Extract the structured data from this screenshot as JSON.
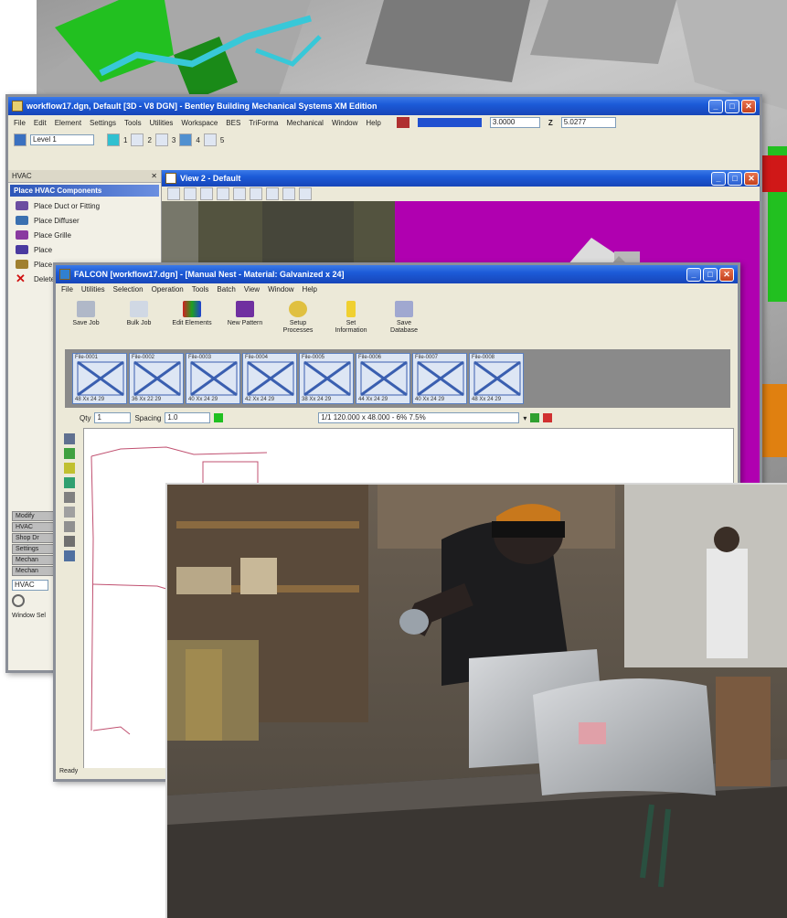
{
  "bentley_window": {
    "title": "workflow17.dgn, Default [3D - V8 DGN] - Bentley Building Mechanical Systems XM Edition",
    "menus": [
      "File",
      "Edit",
      "Element",
      "Settings",
      "Tools",
      "Utilities",
      "Workspace",
      "BES",
      "TriForma",
      "Mechanical",
      "Window",
      "Help"
    ],
    "level_value": "Level 1",
    "z_label": "Z",
    "coord_x": "3.0000",
    "coord_z": "5.0277",
    "toolbar_nums": [
      "1",
      "2",
      "3",
      "4",
      "5"
    ],
    "side_panel": {
      "header": "HVAC",
      "close": "✕",
      "section": "Place HVAC Components",
      "items": [
        "Place Duct or Fitting",
        "Place Diffuser",
        "Place Grille",
        "Place",
        "Place",
        "Delete"
      ],
      "collapsed_tabs": [
        "Modify",
        "HVAC",
        "Shop Dr",
        "Settings",
        "Mechan",
        "Mechan"
      ],
      "bottom_select": "HVAC",
      "status": "Window Sel"
    },
    "view": {
      "title": "View 2 - Default"
    }
  },
  "fab_window": {
    "title": "FALCON [workflow17.dgn] - [Manual Nest - Material: Galvanized x 24]",
    "menus": [
      "File",
      "Utilities",
      "Selection",
      "Operation",
      "Tools",
      "Batch",
      "View",
      "Window",
      "Help"
    ],
    "big_tools": [
      "Save Job",
      "Bulk Job",
      "Edit Elements",
      "New Pattern",
      "Setup Processes",
      "Set Information",
      "Save Database"
    ],
    "thumbnails": [
      {
        "top": "File-0001",
        "bottom": "48 Xx 24 29"
      },
      {
        "top": "File-0002",
        "bottom": "36 Xx 22 29"
      },
      {
        "top": "File-0003",
        "bottom": "40 Xx 24 29"
      },
      {
        "top": "File-0004",
        "bottom": "42 Xx 24 29"
      },
      {
        "top": "File-0005",
        "bottom": "38 Xx 24 29"
      },
      {
        "top": "File-0006",
        "bottom": "44 Xx 24 29"
      },
      {
        "top": "File-0007",
        "bottom": "40 Xx 24 29"
      },
      {
        "top": "File-0008",
        "bottom": "48 Xx 24 29"
      }
    ],
    "nest_bar": {
      "qty_label": "Qty",
      "qty_value": "1",
      "spacing_label": "Spacing",
      "spacing_value": "1.0",
      "sheet_value": "1/1 120.000 x 48.000 - 6% 7.5%"
    },
    "status": "Ready"
  },
  "colors": {
    "xp_blue": "#1c5bd8",
    "magenta": "#b000b0",
    "cyan_pipe": "#38c8d8",
    "green_box": "#22c020"
  },
  "icons": {
    "close": "✕",
    "minimize": "_",
    "maximize": "□",
    "delete": "✕",
    "dropdown": "▾"
  }
}
